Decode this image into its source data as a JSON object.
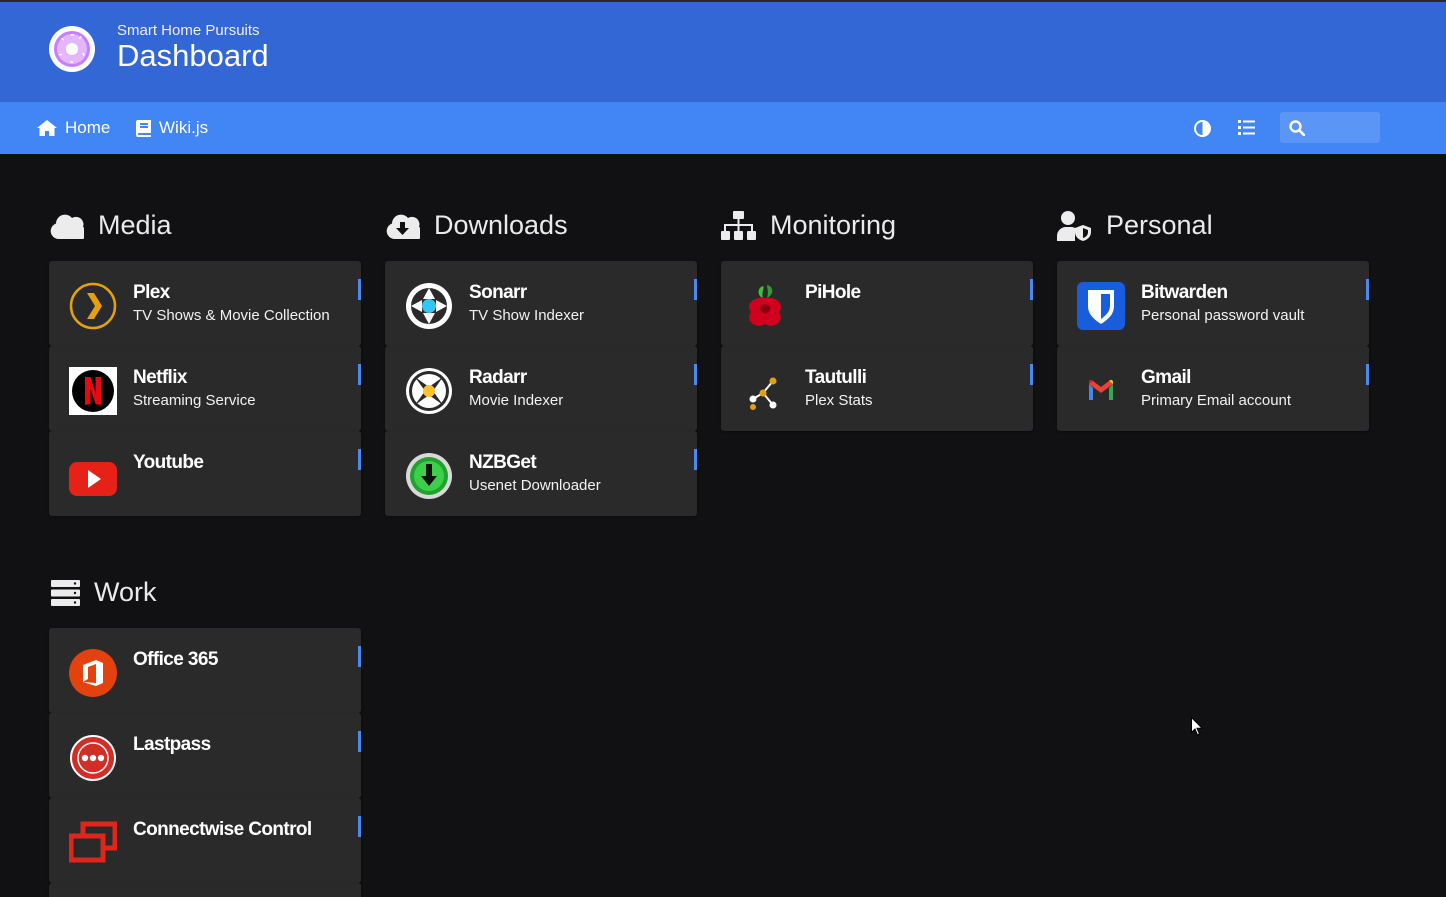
{
  "header": {
    "subtitle": "Smart Home Pursuits",
    "title": "Dashboard",
    "logo_icon": "donut-logo-icon",
    "color": "#3367d6"
  },
  "navbar": {
    "color": "#4285f4",
    "links": [
      {
        "label": "Home",
        "icon": "home-icon"
      },
      {
        "label": "Wiki.js",
        "icon": "book-icon"
      }
    ],
    "search_value": "",
    "actions": [
      "theme-toggle-icon",
      "list-layout-icon",
      "search-icon"
    ]
  },
  "groups": {
    "media": {
      "title": "Media",
      "icon": "cloud-icon",
      "items": [
        {
          "name": "Plex",
          "subtitle": "TV Shows & Movie Collection",
          "icon": "plex-icon"
        },
        {
          "name": "Netflix",
          "subtitle": "Streaming Service",
          "icon": "netflix-icon"
        },
        {
          "name": "Youtube",
          "subtitle": "",
          "icon": "youtube-icon"
        }
      ]
    },
    "downloads": {
      "title": "Downloads",
      "icon": "cloud-download-icon",
      "items": [
        {
          "name": "Sonarr",
          "subtitle": "TV Show Indexer",
          "icon": "sonarr-icon"
        },
        {
          "name": "Radarr",
          "subtitle": "Movie Indexer",
          "icon": "radarr-icon"
        },
        {
          "name": "NZBGet",
          "subtitle": "Usenet Downloader",
          "icon": "nzbget-icon"
        }
      ]
    },
    "monitoring": {
      "title": "Monitoring",
      "icon": "network-icon",
      "items": [
        {
          "name": "PiHole",
          "subtitle": "",
          "icon": "pihole-icon"
        },
        {
          "name": "Tautulli",
          "subtitle": "Plex Stats",
          "icon": "tautulli-icon"
        }
      ]
    },
    "personal": {
      "title": "Personal",
      "icon": "user-shield-icon",
      "items": [
        {
          "name": "Bitwarden",
          "subtitle": "Personal password vault",
          "icon": "bitwarden-icon"
        },
        {
          "name": "Gmail",
          "subtitle": "Primary Email account",
          "icon": "gmail-icon"
        }
      ]
    },
    "work": {
      "title": "Work",
      "icon": "server-icon",
      "items": [
        {
          "name": "Office 365",
          "subtitle": "",
          "icon": "office-icon"
        },
        {
          "name": "Lastpass",
          "subtitle": "",
          "icon": "lastpass-icon"
        },
        {
          "name": "Connectwise Control",
          "subtitle": "",
          "icon": "connectwise-icon"
        }
      ]
    }
  },
  "accent_color": "#4a89f3"
}
